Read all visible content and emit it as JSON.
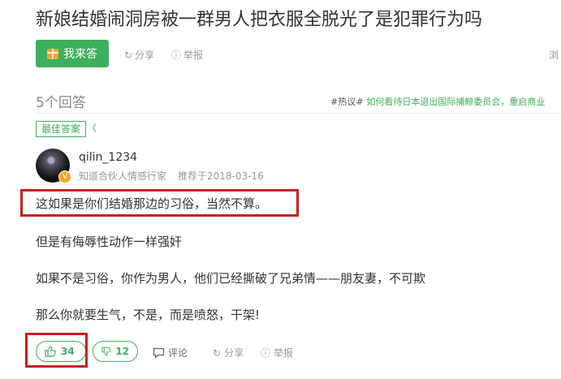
{
  "question": {
    "title": "新娘结婚闹洞房被一群男人把衣服全脱光了是犯罪行为吗"
  },
  "toolbar": {
    "answer_label": "我来答",
    "share_label": "分享",
    "report_label": "举报",
    "browse_label": "浏"
  },
  "answers_header": {
    "count_label": "5个回答",
    "hot_tag": "#热议#",
    "hot_link": "如何看待日本退出国际捕鲸委员会，重启商业"
  },
  "best_answer": {
    "badge": "最佳答案",
    "author": "qilin_1234",
    "author_title": "知道合伙人情感行家",
    "date": "推荐于2018-03-16",
    "paragraphs": [
      "这如果是你们结婚那边的习俗，当然不算。",
      "但是有侮辱性动作一样强奸",
      "如果不是习俗，你作为男人，他们已经撕破了兄弟情——朋友妻，不可欺",
      "那么你就要生气，不是，而是喷怒，干架!"
    ],
    "actions": {
      "likes": "34",
      "dislikes": "12",
      "comment_label": "评论",
      "share_label": "分享",
      "report_label": "举报"
    }
  },
  "colors": {
    "accent": "#3eaf5c",
    "highlight": "#c8201f"
  }
}
